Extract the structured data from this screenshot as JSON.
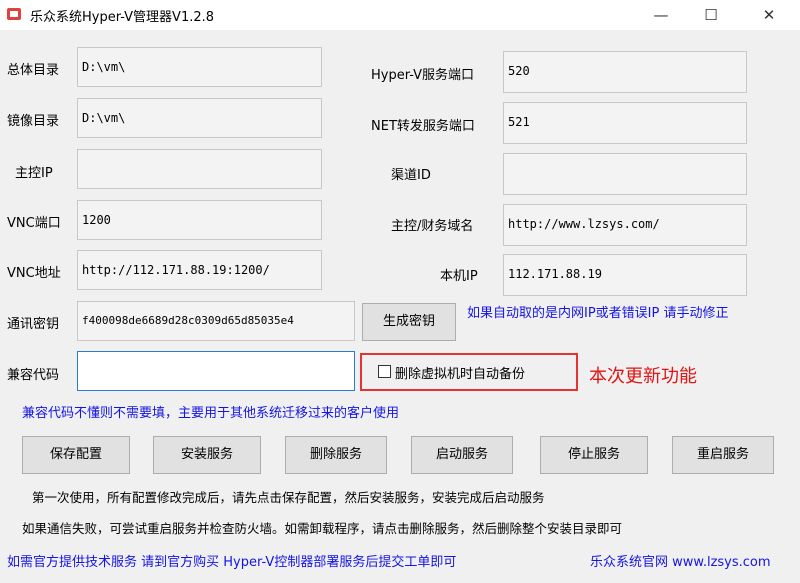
{
  "window": {
    "title": "乐众系统Hyper-V管理器V1.2.8",
    "controls": {
      "minimize": "—",
      "maximize": "☐",
      "close": "✕"
    }
  },
  "form": {
    "root_dir": {
      "label": "总体目录",
      "value": "D:\\vm\\"
    },
    "image_dir": {
      "label": "镜像目录",
      "value": "D:\\vm\\"
    },
    "master_ip": {
      "label": "主控IP",
      "value": ""
    },
    "vnc_port": {
      "label": "VNC端口",
      "value": "1200"
    },
    "vnc_addr": {
      "label": "VNC地址",
      "value": "http://112.171.88.19:1200/"
    },
    "comm_key": {
      "label": "通讯密钥",
      "value": "f400098de6689d28c0309d65d85035e4"
    },
    "compat_code": {
      "label": "兼容代码",
      "value": ""
    },
    "hyperv_port": {
      "label": "Hyper-V服务端口",
      "value": "520"
    },
    "net_port": {
      "label": "NET转发服务端口",
      "value": "521"
    },
    "channel_id": {
      "label": "渠道ID",
      "value": ""
    },
    "domain": {
      "label": "主控/财务域名",
      "value": "http://www.lzsys.com/"
    },
    "local_ip": {
      "label": "本机IP",
      "value": "112.171.88.19"
    }
  },
  "generate_key_button": "生成密钥",
  "backup_checkbox": {
    "label": "删除虚拟机时自动备份",
    "checked": false
  },
  "new_feature_label": "本次更新功能",
  "ip_hint": "如果自动取的是内网IP或者错误IP 请手动修正",
  "compat_hint": "兼容代码不懂则不需要填，主要用于其他系统迁移过来的客户使用",
  "buttons": [
    "保存配置",
    "安装服务",
    "删除服务",
    "启动服务",
    "停止服务",
    "重启服务"
  ],
  "notes": [
    "第一次使用，所有配置修改完成后，请先点击保存配置，然后安装服务，安装完成后启动服务",
    "如果通信失败，可尝试重启服务并检查防火墙。如需卸载程序，请点击删除服务，然后删除整个安装目录即可"
  ],
  "footer": {
    "support": "如需官方提供技术服务 请到官方购买 Hyper-V控制器部署服务后提交工单即可",
    "site": "乐众系统官网 www.lzsys.com"
  },
  "colors": {
    "link_blue": "#1414e6",
    "highlight_red": "#e11414"
  }
}
